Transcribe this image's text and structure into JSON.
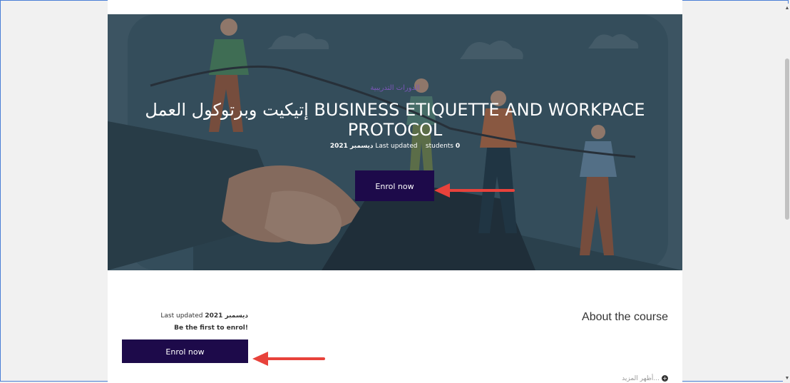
{
  "hero": {
    "category": "الدورات التدريبية",
    "title": "إتيكيت وبرتوكول العمل BUSINESS ETIQUETTE AND WORKPACE PROTOCOL",
    "meta_students_count": "0",
    "meta_students_label": "students",
    "meta_updated_label": "Last updated",
    "meta_updated_value": "ديسمبر 2021",
    "enrol_label": "Enrol now"
  },
  "side": {
    "updated_label": "Last updated",
    "updated_value": "ديسمبر 2021",
    "first_to_enrol": "Be the first to enrol!",
    "enrol_label": "Enrol now"
  },
  "about": {
    "heading": "About the course",
    "show_more": "أظهر المزيد..."
  },
  "colors": {
    "button": "#1d0a4a",
    "arrow": "#e8423b",
    "hero_bg": "#3f5966"
  }
}
